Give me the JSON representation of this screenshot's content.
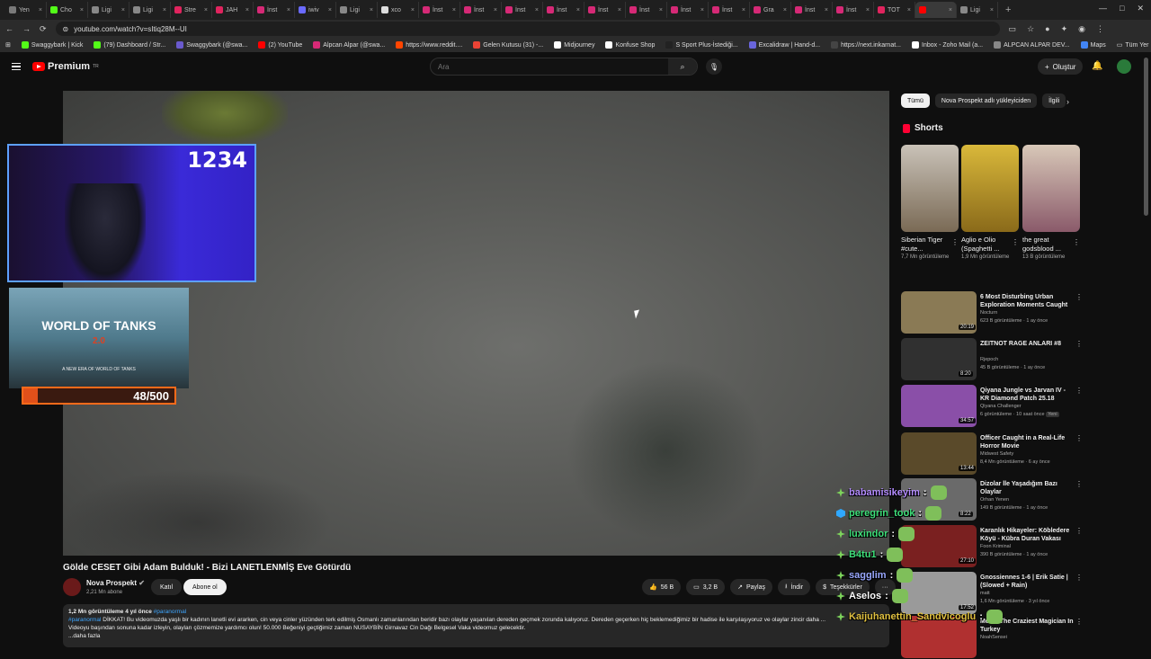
{
  "browser": {
    "tabs": [
      {
        "label": "Yen",
        "color": "#7a7a7a"
      },
      {
        "label": "Cho",
        "color": "#53fc18"
      },
      {
        "label": "Ligi",
        "color": "#888888"
      },
      {
        "label": "Ligi",
        "color": "#888888"
      },
      {
        "label": "Stre",
        "color": "#e0245e"
      },
      {
        "label": "JAH",
        "color": "#e0245e"
      },
      {
        "label": "İnst",
        "color": "#d62976"
      },
      {
        "label": "iwiv",
        "color": "#6a6aff"
      },
      {
        "label": "Ligi",
        "color": "#888888"
      },
      {
        "label": "xco",
        "color": "#dddddd"
      },
      {
        "label": "İnst",
        "color": "#d62976"
      },
      {
        "label": "İnst",
        "color": "#d62976"
      },
      {
        "label": "İnst",
        "color": "#d62976"
      },
      {
        "label": "İnst",
        "color": "#d62976"
      },
      {
        "label": "İnst",
        "color": "#d62976"
      },
      {
        "label": "İnst",
        "color": "#d62976"
      },
      {
        "label": "İnst",
        "color": "#d62976"
      },
      {
        "label": "İnst",
        "color": "#d62976"
      },
      {
        "label": "Gra",
        "color": "#d62976"
      },
      {
        "label": "İnst",
        "color": "#d62976"
      },
      {
        "label": "İnst",
        "color": "#d62976"
      },
      {
        "label": "TOT",
        "color": "#e0245e"
      },
      {
        "label": "",
        "color": "#ff0000"
      },
      {
        "label": "Ligi",
        "color": "#888888"
      }
    ],
    "active_tab_index": 22,
    "url": "youtube.com/watch?v=sItiq28M--UI",
    "bookmarks": [
      {
        "label": "Swaggybark | Kick",
        "color": "#53fc18"
      },
      {
        "label": "(79) Dashboard / Str...",
        "color": "#53fc18"
      },
      {
        "label": "Swaggybark (@swa...",
        "color": "#6a5acd"
      },
      {
        "label": "(2) YouTube",
        "color": "#ff0000"
      },
      {
        "label": "Alpcan Alpar (@swa...",
        "color": "#d62976"
      },
      {
        "label": "https://www.reddit....",
        "color": "#ff4500"
      },
      {
        "label": "Gelen Kutusu (31) -...",
        "color": "#ea4335"
      },
      {
        "label": "Midjourney",
        "color": "#ffffff"
      },
      {
        "label": "Konfuse Shop",
        "color": "#ffffff"
      },
      {
        "label": "S Sport Plus-İstediği...",
        "color": "#222222"
      },
      {
        "label": "Excalidraw | Hand-d...",
        "color": "#6965db"
      },
      {
        "label": "https://next.inkarnat...",
        "color": "#444444"
      },
      {
        "label": "Inbox - Zoho Mail (a...",
        "color": "#ffffff"
      },
      {
        "label": "ALPCAN ALPAR DEV...",
        "color": "#888888"
      },
      {
        "label": "Maps",
        "color": "#4285f4"
      }
    ],
    "all_bookmarks_label": "Tüm Yer İşaretleri"
  },
  "youtube": {
    "logo_text": "Premium",
    "logo_sup": "TR",
    "search_placeholder": "Ara",
    "create_label": "Oluştur"
  },
  "overlay": {
    "cam_counter": "1234",
    "game_title": "WORLD OF TANKS",
    "game_version": "2.0",
    "game_tagline": "A NEW ERA OF WORLD OF TANKS",
    "goal_text": "48/500",
    "goal_progress": 0.096
  },
  "video": {
    "title": "Gölde CESET Gibi Adam Bulduk! - Bizi LANETLENMİŞ Eve Götürdü",
    "channel": "Nova Prospekt",
    "subscribers": "2,21 Mn abone",
    "join_label": "Katıl",
    "subscribe_label": "Abone ol",
    "likes": "56 B",
    "comments": "3,2 B",
    "share_label": "Paylaş",
    "download_label": "İndir",
    "thanks_label": "Teşekkürler",
    "more_label": "···",
    "views_meta": "1,2 Mn görüntüleme  4 yıl önce",
    "meta_tag": "#paranormal",
    "desc_tag": "#paranormal",
    "desc_line1": " DİKKAT! Bu videomuzda yaşlı bir kadının lanetli evi ararken, cin veya cinler yüzünden terk edilmiş Osmanlı zamanlarından beridir bazı olaylar yaşanılan dereden geçmek zorunda kalıyoruz. Dereden geçerken hiç beklemediğimiz bir hadise ile karşılaşıyoruz ve olaylar zincir daha ...",
    "desc_line2": "Videoyu başından sonuna kadar izleyin, olayları çözmemize yardımcı olun! 50.000 Beğeniyi geçtiğimiz zaman NUSAYBİN Girnavaz Cin Dağı Belgesel Vaka videomuz gelecektir.",
    "desc_more": "...daha fazla"
  },
  "sidebar": {
    "chips": [
      "Tümü",
      "Nova Prospekt adlı yükleyiciden",
      "İlgili"
    ],
    "shorts_label": "Shorts",
    "shorts": [
      {
        "title": "Siberian Tiger #cute...",
        "views": "7,7 Mn görüntüleme"
      },
      {
        "title": "Aglio e Olio (Spaghetti ...",
        "views": "1,9 Mn görüntüleme"
      },
      {
        "title": "the great godsblood ...",
        "views": "13 B görüntüleme"
      }
    ],
    "recommendations": [
      {
        "title": "6 Most Disturbing Urban Exploration Moments Caught ...",
        "channel": "Nocturn",
        "views": "623 B görüntüleme · 1 ay önce",
        "duration": "20:19",
        "color": "#8a7a55"
      },
      {
        "title": "ZEITNOT RAGE ANLARI #8",
        "channel": "Rjepoch",
        "views": "45 B görüntüleme · 1 ay önce",
        "duration": "8:20",
        "color": "#303030"
      },
      {
        "title": "Qiyana Jungle vs Jarvan IV - KR Diamond Patch 25.18",
        "channel": "Qiyana Challenger",
        "views": "6 görüntüleme · 10 saat önce",
        "badge": "Yeni",
        "duration": "34:57",
        "color": "#8a4fa8"
      },
      {
        "title": "Officer Caught in a Real-Life Horror Movie",
        "channel": "Midwest Safety",
        "views": "8,4 Mn görüntüleme · 6 ay önce",
        "duration": "13:44",
        "color": "#5a4a2a"
      },
      {
        "title": "Dizolar İle Yaşadığım Bazı Olaylar",
        "channel": "Orhan Yenen",
        "views": "149 B görüntüleme · 1 ay önce",
        "duration": "8:22",
        "color": "#6a6a6a"
      },
      {
        "title": "Karanlık Hikayeler: Köbledere Köyü - Kübra Duran Vakası",
        "channel": "Foon Kriminal",
        "views": "390 B görüntüleme · 1 ay önce",
        "duration": "27:10",
        "color": "#7a2020"
      },
      {
        "title": "Gnossiennes 1-6 | Erik Satie | (Slowed + Rain)",
        "channel": "matt",
        "views": "1,6 Mn görüntüleme · 3 yıl önce",
        "duration": "17:52",
        "color": "#9a9a9a"
      },
      {
        "title": "Meets The Craziest Magician In Turkey",
        "channel": "NoahSensei",
        "views": "",
        "duration": "",
        "color": "#b03030"
      }
    ]
  },
  "chat": [
    {
      "user": "babamisikeyim",
      "color": "#b48cff",
      "badge": "green",
      "suffix": ":"
    },
    {
      "user": "peregrin_took",
      "color": "#3ee07a",
      "badge": "blue",
      "suffix": ":"
    },
    {
      "user": "luxindor",
      "color": "#3ee07a",
      "badge": "green",
      "suffix": ":"
    },
    {
      "user": "B4tu1",
      "color": "#3ee07a",
      "badge": "green",
      "suffix": ":"
    },
    {
      "user": "sagglim",
      "color": "#9aa8ff",
      "badge": "green",
      "suffix": ":"
    },
    {
      "user": "Aselos",
      "color": "#ffffff",
      "badge": "green",
      "suffix": ":"
    },
    {
      "user": "Kaijuhanettin_Sandvicoglu",
      "color": "#e0c040",
      "badge": "green",
      "suffix": ":"
    }
  ]
}
